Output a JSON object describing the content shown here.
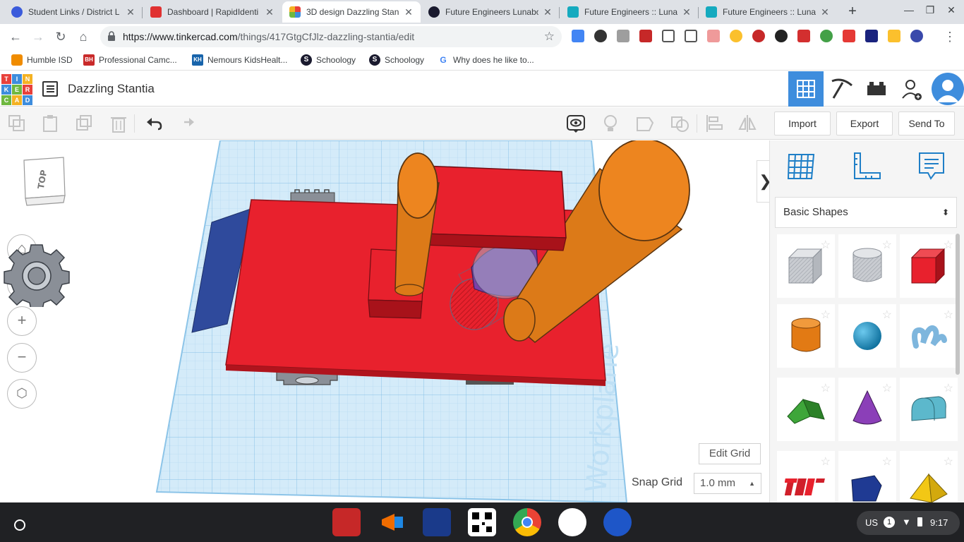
{
  "browser": {
    "tabs": [
      {
        "label": "Student Links / District L",
        "color": "#3b5bdb"
      },
      {
        "label": "Dashboard | RapidIdenti",
        "color": "#e03131"
      },
      {
        "label": "3D design Dazzling Stan",
        "color": "#f08c00"
      },
      {
        "label": "Future Engineers Lunabo",
        "color": "#1a1a2e"
      },
      {
        "label": "Future Engineers :: Luna",
        "color": "#15aabf"
      },
      {
        "label": "Future Engineers :: Luna",
        "color": "#15aabf"
      }
    ],
    "new_tab": "+",
    "url_host": "https://www.tinkercad.com",
    "url_path": "/things/417GtgCfJlz-dazzling-stantia/edit"
  },
  "bookmarks": [
    {
      "label": "Humble ISD",
      "badge": "",
      "color": "#f08c00"
    },
    {
      "label": "Professional Camc...",
      "badge": "BH",
      "color": "#c92a2a"
    },
    {
      "label": "Nemours KidsHealt...",
      "badge": "KH",
      "color": "#1864ab"
    },
    {
      "label": "Schoology",
      "badge": "S",
      "color": "#1a1a2e"
    },
    {
      "label": "Schoology",
      "badge": "S",
      "color": "#1a1a2e"
    },
    {
      "label": "Why does he like to...",
      "badge": "G",
      "color": "#4285f4"
    }
  ],
  "app": {
    "logo_letters": [
      "T",
      "I",
      "N",
      "K",
      "E",
      "R",
      "C",
      "A",
      "D"
    ],
    "logo_colors": [
      "#e8413b",
      "#3e8ddd",
      "#f4b223",
      "#3e8ddd",
      "#6fb840",
      "#e8413b",
      "#6fb840",
      "#f4b223",
      "#3e8ddd"
    ],
    "design_title": "Dazzling Stantia"
  },
  "toolbar": {
    "import_label": "Import",
    "export_label": "Export",
    "send_to_label": "Send To"
  },
  "workspace": {
    "viewcube_label": "TOP",
    "workplane_label": "Workplane",
    "edit_grid_label": "Edit Grid",
    "snap_grid_label": "Snap Grid",
    "snap_grid_value": "1.0 mm",
    "zoom_in": "+",
    "zoom_out": "−"
  },
  "panel": {
    "category": "Basic Shapes",
    "shapes": [
      {
        "name": "Box Hole"
      },
      {
        "name": "Cylinder Hole"
      },
      {
        "name": "Box"
      },
      {
        "name": "Cylinder"
      },
      {
        "name": "Sphere"
      },
      {
        "name": "Scribble"
      },
      {
        "name": "Roof"
      },
      {
        "name": "Cone"
      },
      {
        "name": "Round Roof"
      },
      {
        "name": "Text"
      },
      {
        "name": "Polygon"
      },
      {
        "name": "Pyramid"
      }
    ]
  },
  "shelf": {
    "locale": "US",
    "badge": "1",
    "time": "9:17"
  },
  "colors": {
    "accent": "#3e8ddd",
    "shape_red": "#e8212d",
    "shape_orange": "#ed851f",
    "shape_blue": "#2f4a9c",
    "grid_blue": "#c9e4f6"
  }
}
